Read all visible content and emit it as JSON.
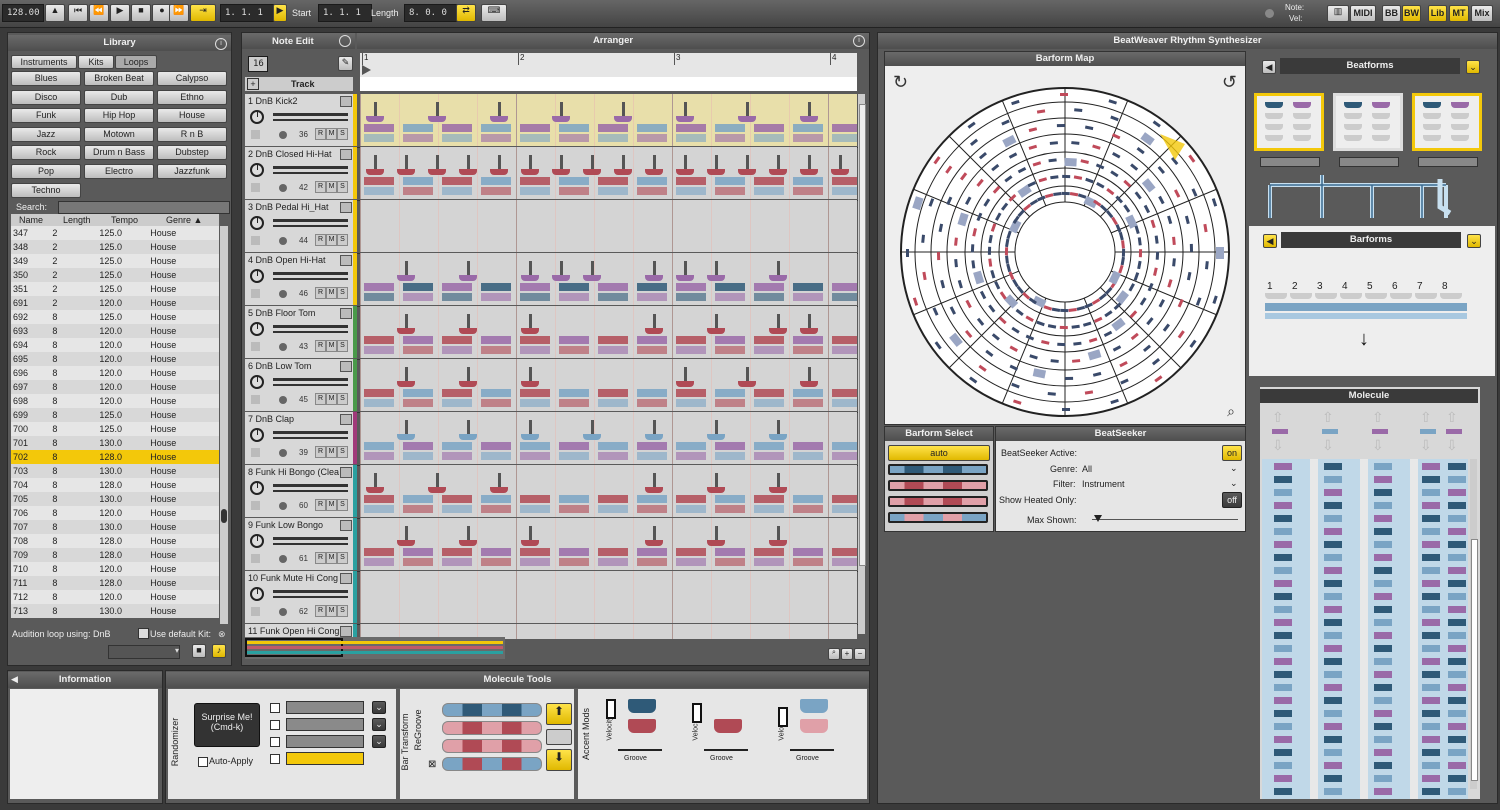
{
  "transport": {
    "tempo": "128.00",
    "position": "1. 1. 1",
    "start_label": "Start",
    "start": "1. 1. 1",
    "length_label": "Length",
    "length": "8. 0. 0"
  },
  "topright": {
    "note_label": "Note:",
    "vel_label": "Vel:",
    "buttons": [
      "MIDI",
      "BB",
      "BW",
      "Lib",
      "MT",
      "Mix"
    ]
  },
  "library": {
    "title": "Library",
    "tabs": [
      "Instruments",
      "Kits",
      "Loops"
    ],
    "active_tab": "Loops",
    "genres": [
      "Blues",
      "Broken Beat",
      "Calypso",
      "Disco",
      "Dub",
      "Ethno",
      "Funk",
      "Hip Hop",
      "House",
      "Jazz",
      "Motown",
      "R n B",
      "Rock",
      "Drum n Bass",
      "Dubstep",
      "Pop",
      "Electro",
      "Jazzfunk",
      "Techno"
    ],
    "search_label": "Search:",
    "columns": [
      "Name",
      "Length",
      "Tempo",
      "Genre ▲"
    ],
    "rows": [
      [
        "347",
        "2",
        "125.0",
        "House"
      ],
      [
        "348",
        "2",
        "125.0",
        "House"
      ],
      [
        "349",
        "2",
        "125.0",
        "House"
      ],
      [
        "350",
        "2",
        "125.0",
        "House"
      ],
      [
        "351",
        "2",
        "125.0",
        "House"
      ],
      [
        "691",
        "2",
        "120.0",
        "House"
      ],
      [
        "692",
        "8",
        "125.0",
        "House"
      ],
      [
        "693",
        "8",
        "120.0",
        "House"
      ],
      [
        "694",
        "8",
        "120.0",
        "House"
      ],
      [
        "695",
        "8",
        "120.0",
        "House"
      ],
      [
        "696",
        "8",
        "120.0",
        "House"
      ],
      [
        "697",
        "8",
        "120.0",
        "House"
      ],
      [
        "698",
        "8",
        "120.0",
        "House"
      ],
      [
        "699",
        "8",
        "125.0",
        "House"
      ],
      [
        "700",
        "8",
        "125.0",
        "House"
      ],
      [
        "701",
        "8",
        "130.0",
        "House"
      ],
      [
        "702",
        "8",
        "128.0",
        "House"
      ],
      [
        "703",
        "8",
        "130.0",
        "House"
      ],
      [
        "704",
        "8",
        "128.0",
        "House"
      ],
      [
        "705",
        "8",
        "130.0",
        "House"
      ],
      [
        "706",
        "8",
        "120.0",
        "House"
      ],
      [
        "707",
        "8",
        "130.0",
        "House"
      ],
      [
        "708",
        "8",
        "128.0",
        "House"
      ],
      [
        "709",
        "8",
        "128.0",
        "House"
      ],
      [
        "710",
        "8",
        "120.0",
        "House"
      ],
      [
        "711",
        "8",
        "128.0",
        "House"
      ],
      [
        "712",
        "8",
        "120.0",
        "House"
      ],
      [
        "713",
        "8",
        "130.0",
        "House"
      ]
    ],
    "selected_row": "702",
    "audition_label": "Audition loop using: DnB",
    "default_kit_label": "Use default Kit:"
  },
  "info": {
    "title": "Information"
  },
  "note_edit": {
    "title": "Note Edit",
    "value": "16",
    "track_label": "Track"
  },
  "arranger": {
    "title": "Arranger",
    "bars": [
      "1",
      "2",
      "3",
      "4"
    ],
    "tracks": [
      {
        "name": "1 DnB Kick2",
        "num": "36",
        "color": "#f3c80a"
      },
      {
        "name": "2 DnB Closed Hi-Hat",
        "num": "42",
        "color": "#f3c80a"
      },
      {
        "name": "3 DnB Pedal Hi_Hat",
        "num": "44",
        "color": "#f3c80a"
      },
      {
        "name": "4 DnB Open Hi-Hat",
        "num": "46",
        "color": "#f3c80a"
      },
      {
        "name": "5 DnB Floor Tom",
        "num": "43",
        "color": "#4a9a4a"
      },
      {
        "name": "6 DnB Low Tom",
        "num": "45",
        "color": "#4a9a4a"
      },
      {
        "name": "7 DnB Clap",
        "num": "39",
        "color": "#a03a7a"
      },
      {
        "name": "8 Funk Hi Bongo (Clea",
        "num": "60",
        "color": "#2aa0a0"
      },
      {
        "name": "9 Funk Low Bongo",
        "num": "61",
        "color": "#2aa0a0"
      },
      {
        "name": "10 Funk Mute Hi Cong",
        "num": "62",
        "color": "#2aa0a0"
      },
      {
        "name": "11 Funk Open Hi Cong",
        "num": "",
        "color": "#2aa0a0"
      }
    ]
  },
  "molecule_tools": {
    "title": "Molecule Tools",
    "randomizer_label": "Randomizer",
    "surprise_btn": "Surprise Me!\n(Cmd-k)",
    "auto_apply": "Auto-Apply",
    "bar_transform_label": "Bar Transform",
    "regroove_label": "ReGroove",
    "accent_mods_label": "Accent Mods",
    "velocity_label": "Velocity",
    "groove_label": "Groove"
  },
  "synth": {
    "title": "BeatWeaver Rhythm Synthesizer",
    "barform_map": "Barform Map",
    "beatforms": "Beatforms",
    "barforms": "Barforms",
    "molecule": "Molecule",
    "barforms_numbers": [
      "1",
      "2",
      "3",
      "4",
      "5",
      "6",
      "7",
      "8"
    ]
  },
  "barform_select": {
    "title": "Barform Select",
    "auto": "auto"
  },
  "beatseeker": {
    "title": "BeatSeeker",
    "active_label": "BeatSeeker Active:",
    "active_value": "on",
    "genre_label": "Genre:",
    "genre_value": "All",
    "filter_label": "Filter:",
    "filter_value": "Instrument",
    "heated_label": "Show Heated Only:",
    "heated_value": "off",
    "max_label": "Max Shown:"
  },
  "colors": {
    "yellow": "#f3c80a",
    "blue": "#7aa4c4",
    "darkblue": "#2f5a78",
    "pink": "#e0a0a8",
    "red": "#b04a55",
    "purple": "#9a6aa8"
  }
}
